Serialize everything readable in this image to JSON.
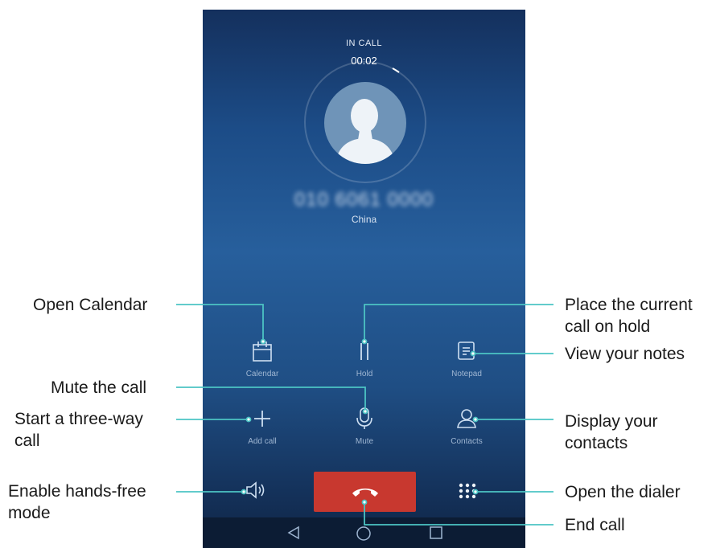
{
  "phone_screen": {
    "status": "IN CALL",
    "timer": "00:02",
    "number": "010 6061 0000",
    "country": "China",
    "buttons": {
      "calendar": "Calendar",
      "hold": "Hold",
      "notepad": "Notepad",
      "add_call": "Add call",
      "mute": "Mute",
      "contacts": "Contacts"
    },
    "icons": [
      "calendar-icon",
      "hold-icon",
      "notepad-icon",
      "add-call-icon",
      "mute-icon",
      "contacts-icon",
      "speaker-icon",
      "end-call-icon",
      "dialpad-icon",
      "back-nav-icon",
      "home-nav-icon",
      "recents-nav-icon"
    ],
    "colors": {
      "end_call": "#c8382f",
      "callout_line": "#4cc4c4"
    }
  },
  "callouts": {
    "open_calendar": "Open Calendar",
    "mute_call": "Mute the call",
    "three_way": [
      "Start a three-way",
      "call"
    ],
    "hands_free": [
      "Enable hands-free",
      "mode"
    ],
    "hold": [
      "Place the current",
      "call on hold"
    ],
    "notes": "View your notes",
    "contacts": [
      "Display your",
      "contacts"
    ],
    "dialer": "Open the dialer",
    "end_call": "End call"
  }
}
